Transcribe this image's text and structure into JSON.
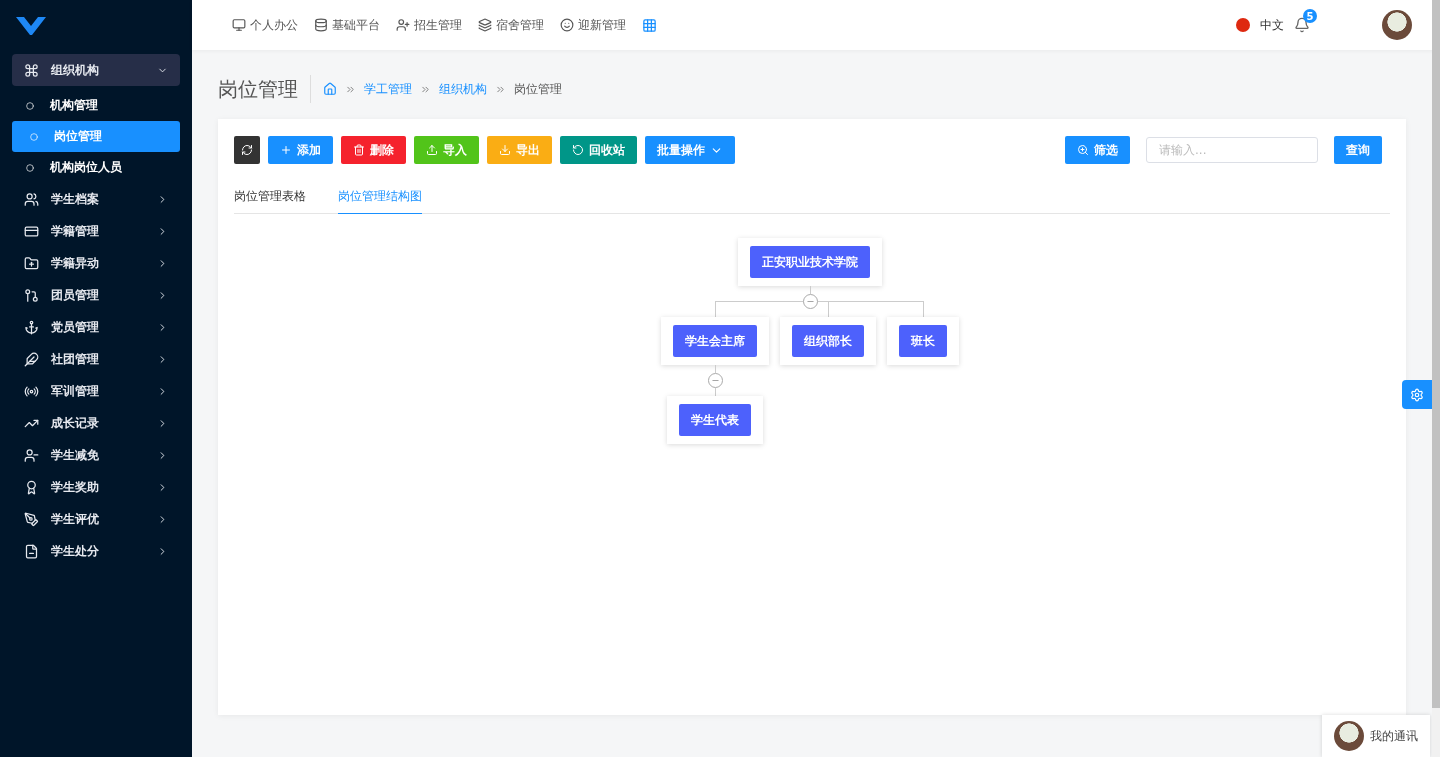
{
  "top_nav": [
    {
      "label": "个人办公"
    },
    {
      "label": "基础平台"
    },
    {
      "label": "招生管理"
    },
    {
      "label": "宿舍管理"
    },
    {
      "label": "迎新管理"
    }
  ],
  "header": {
    "language": "中文",
    "notifications": "5"
  },
  "sidebar": {
    "items": [
      {
        "label": "组织机构",
        "expanded": true,
        "children": [
          {
            "label": "机构管理",
            "selected": false
          },
          {
            "label": "岗位管理",
            "selected": true
          },
          {
            "label": "机构岗位人员",
            "selected": false
          }
        ]
      },
      {
        "label": "学生档案",
        "expanded": false
      },
      {
        "label": "学籍管理",
        "expanded": false
      },
      {
        "label": "学籍异动",
        "expanded": false
      },
      {
        "label": "团员管理",
        "expanded": false
      },
      {
        "label": "党员管理",
        "expanded": false
      },
      {
        "label": "社团管理",
        "expanded": false
      },
      {
        "label": "军训管理",
        "expanded": false
      },
      {
        "label": "成长记录",
        "expanded": false
      },
      {
        "label": "学生减免",
        "expanded": false
      },
      {
        "label": "学生奖助",
        "expanded": false
      },
      {
        "label": "学生评优",
        "expanded": false
      },
      {
        "label": "学生处分",
        "expanded": false
      }
    ]
  },
  "page": {
    "title": "岗位管理",
    "breadcrumb": [
      {
        "label": "学工管理",
        "kind": "link"
      },
      {
        "label": "组织机构",
        "kind": "link"
      },
      {
        "label": "岗位管理",
        "kind": "current"
      }
    ]
  },
  "toolbar": {
    "buttons": [
      {
        "kind": "icon",
        "color": "#333333"
      },
      {
        "kind": "plain",
        "label": "添加",
        "color": "#1890ff"
      },
      {
        "kind": "plain",
        "label": "删除",
        "color": "#f5222d"
      },
      {
        "kind": "plain",
        "label": "导入",
        "color": "#52c41a"
      },
      {
        "kind": "plain",
        "label": "导出",
        "color": "#faad14"
      },
      {
        "kind": "plain",
        "label": "回收站",
        "color": "#009688"
      },
      {
        "kind": "dropdown",
        "label": "批量操作",
        "color": "#1890ff"
      }
    ],
    "filter_button": "筛选",
    "search": {
      "placeholder": "请输入..."
    },
    "query_button": "查询"
  },
  "tabs": [
    {
      "label": "岗位管理表格",
      "selected": false
    },
    {
      "label": "岗位管理结构图",
      "selected": true
    }
  ],
  "tree": {
    "label": "正安职业技术学院",
    "expanded": true,
    "children": [
      {
        "label": "学生会主席",
        "expanded": true,
        "children": [
          {
            "label": "学生代表"
          }
        ]
      },
      {
        "label": "组织部长"
      },
      {
        "label": "班长"
      }
    ]
  },
  "contacts_widget": {
    "label": "我的通讯"
  }
}
